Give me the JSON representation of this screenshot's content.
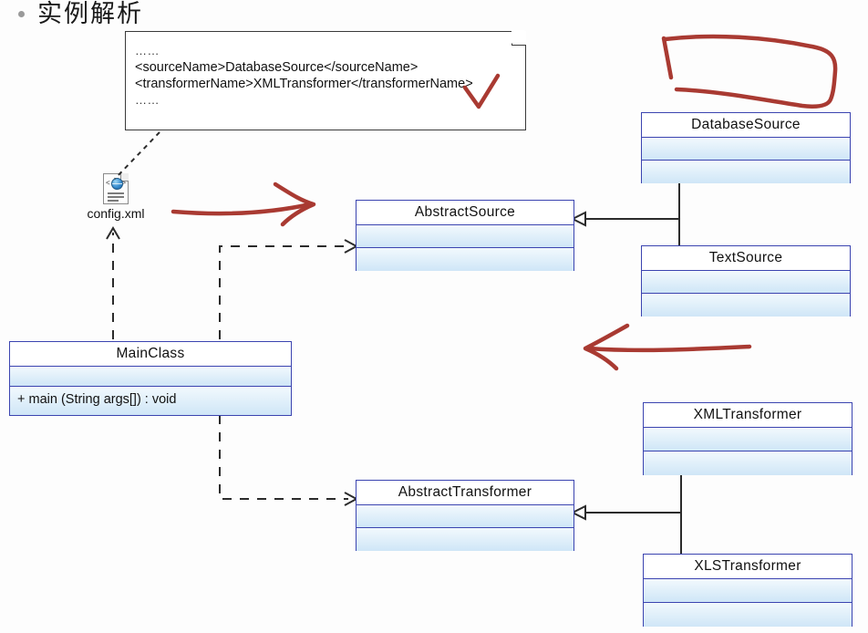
{
  "slide": {
    "bullet_icon": "bullet-dot-icon",
    "title": "实例解析"
  },
  "note": {
    "lines": [
      "……",
      "<sourceName>DatabaseSource</sourceName>",
      "<transformerName>XMLTransformer</transformerName>",
      "……"
    ],
    "fold_icon": "page-fold-corner-icon"
  },
  "config_file": {
    "icon": "xml-document-icon",
    "label": "config.xml"
  },
  "classes": [
    {
      "id": "abstract-source",
      "name": "AbstractSource",
      "members": [],
      "compartments": 2
    },
    {
      "id": "database-source",
      "name": "DatabaseSource",
      "members": [],
      "compartments": 2
    },
    {
      "id": "text-source",
      "name": "TextSource",
      "members": [],
      "compartments": 2
    },
    {
      "id": "main-class",
      "name": "MainClass",
      "members": [
        "+ main (String args[])  : void"
      ],
      "compartments": 2
    },
    {
      "id": "abstract-transformer",
      "name": "AbstractTransformer",
      "members": [],
      "compartments": 2
    },
    {
      "id": "xml-transformer",
      "name": "XMLTransformer",
      "members": [],
      "compartments": 2
    },
    {
      "id": "xls-transformer",
      "name": "XLSTransformer",
      "members": [],
      "compartments": 2
    }
  ],
  "relations": [
    {
      "name": "inheritance-sources-to-abstractsource",
      "type": "generalization",
      "from": [
        "DatabaseSource",
        "TextSource"
      ],
      "to": "AbstractSource"
    },
    {
      "name": "inheritance-transformers-to-abstracttransformer",
      "type": "generalization",
      "from": [
        "XMLTransformer",
        "XLSTransformer"
      ],
      "to": "AbstractTransformer"
    },
    {
      "name": "dependency-mainclass-to-abstractsource",
      "type": "dependency",
      "from": "MainClass",
      "to": "AbstractSource"
    },
    {
      "name": "dependency-mainclass-to-abstracttransformer",
      "type": "dependency",
      "from": "MainClass",
      "to": "AbstractTransformer"
    },
    {
      "name": "dependency-mainclass-to-configxml",
      "type": "dependency",
      "from": "MainClass",
      "to": "config.xml"
    },
    {
      "name": "note-anchor-configxml",
      "type": "note-link",
      "from": "note",
      "to": "config.xml"
    }
  ],
  "annotations": {
    "color": "#a93a32",
    "marks": [
      {
        "name": "red-bracket-shape",
        "shape": "hand-drawn-open-rectangle"
      },
      {
        "name": "red-check-mark",
        "shape": "check"
      },
      {
        "name": "red-arrow-right",
        "shape": "arrow-right"
      },
      {
        "name": "red-arrow-left",
        "shape": "arrow-left"
      }
    ]
  },
  "colors": {
    "class_border": "#3b44b0",
    "compartment_top": "#f2f9fd",
    "compartment_bottom": "#cfe6f7",
    "connector": "#2b2b2b",
    "annotation": "#a93a32",
    "title_text": "#1a1a1a"
  }
}
